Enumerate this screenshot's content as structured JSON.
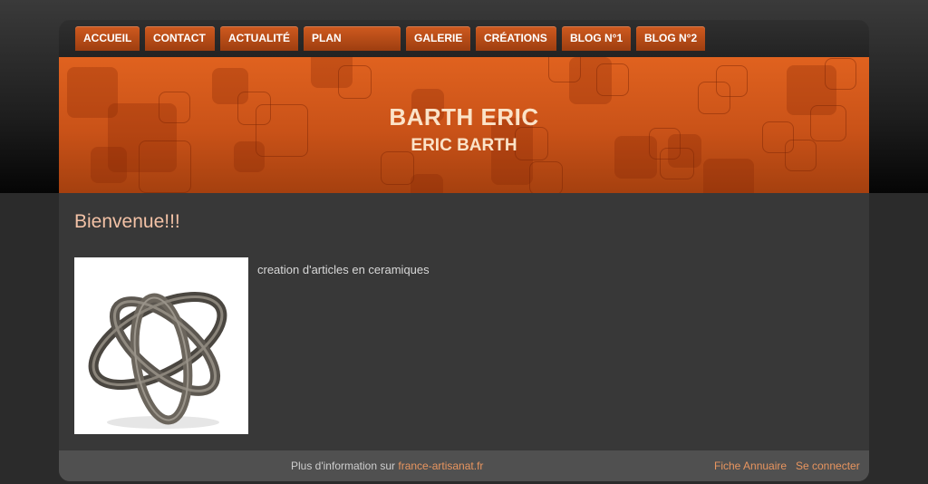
{
  "nav": {
    "items": [
      {
        "label": "ACCUEIL"
      },
      {
        "label": "CONTACT"
      },
      {
        "label": "ACTUALITÉ"
      },
      {
        "label": "PLAN"
      },
      {
        "label": "GALERIE"
      },
      {
        "label": "CRÉATIONS"
      },
      {
        "label": "BLOG N°1"
      },
      {
        "label": "BLOG N°2"
      }
    ]
  },
  "banner": {
    "title": "BARTH ERIC",
    "subtitle": "ERIC BARTH"
  },
  "main": {
    "heading": "Bienvenue!!!",
    "description": "creation d'articles en ceramiques"
  },
  "footer": {
    "info_prefix": "Plus d'information sur",
    "info_link": "france-artisanat.fr",
    "fiche": "Fiche Annuaire",
    "login": "Se connecter"
  },
  "colors": {
    "accent": "#d9581c",
    "link": "#e8955f",
    "heading": "#f3c2a6"
  }
}
